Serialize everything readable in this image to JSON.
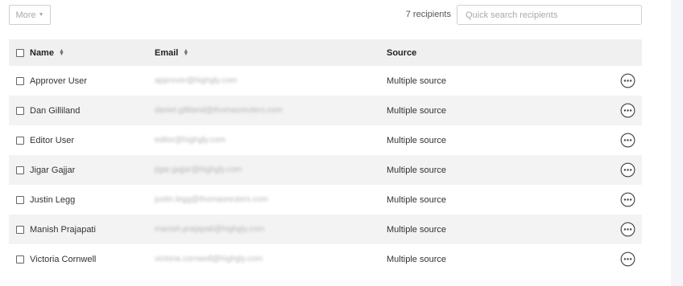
{
  "toolbar": {
    "more_label": "More",
    "recipient_count": "7 recipients",
    "search_placeholder": "Quick search recipients",
    "search_value": ""
  },
  "table": {
    "columns": {
      "name": "Name",
      "email": "Email",
      "source": "Source"
    },
    "rows": [
      {
        "name": "Approver User",
        "email": "approver@highgly.com",
        "source": "Multiple source"
      },
      {
        "name": "Dan Gilliland",
        "email": "daniel.gilliland@thomasreuters.com",
        "source": "Multiple source"
      },
      {
        "name": "Editor User",
        "email": "editor@highgly.com",
        "source": "Multiple source"
      },
      {
        "name": "Jigar Gajjar",
        "email": "jigar.gajjar@highgly.com",
        "source": "Multiple source"
      },
      {
        "name": "Justin Legg",
        "email": "justin.legg@thomasreuters.com",
        "source": "Multiple source"
      },
      {
        "name": "Manish Prajapati",
        "email": "manish.prajapati@highgly.com",
        "source": "Multiple source"
      },
      {
        "name": "Victoria Cornwell",
        "email": "victoria.cornwell@highgly.com",
        "source": "Multiple source"
      }
    ]
  },
  "icons": {
    "sort": "sort-updown-icon",
    "caret": "chevron-down-icon",
    "row_actions": "more-horizontal-circle-icon"
  },
  "colors": {
    "header_bg": "#f0f0f0",
    "stripe_bg": "#f3f3f3",
    "border": "#cfcfcf",
    "muted_text": "#a9a9a9"
  }
}
